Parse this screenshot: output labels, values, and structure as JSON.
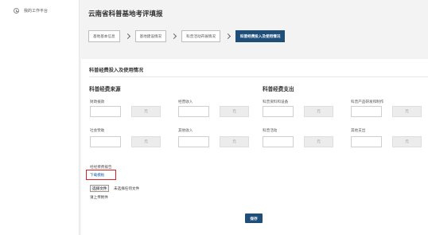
{
  "sidebar": {
    "items": [
      {
        "label": "我的工作平台",
        "icon": "clock-icon"
      }
    ]
  },
  "page": {
    "title": "云南省科普基地考评填报"
  },
  "steps": [
    {
      "label": "基地基本信息",
      "active": false
    },
    {
      "label": "基地建设情况",
      "active": false
    },
    {
      "label": "科普活动开展情况",
      "active": false
    },
    {
      "label": "科普经费投入及使用情况",
      "active": true
    }
  ],
  "form": {
    "title": "科普经费投入及使用情况",
    "income": {
      "title": "科普经费来源",
      "fields": [
        {
          "label": "财政拨款",
          "unit": "元",
          "value": ""
        },
        {
          "label": "经营收入",
          "unit": "元",
          "value": ""
        },
        {
          "label": "社会赞助",
          "unit": "元",
          "value": ""
        },
        {
          "label": "其他收入",
          "unit": "元",
          "value": ""
        }
      ]
    },
    "expense": {
      "title": "科普经费支出",
      "fields": [
        {
          "label": "科普资料和设备",
          "unit": "元",
          "value": ""
        },
        {
          "label": "科普产品研发和制作",
          "unit": "元",
          "value": ""
        },
        {
          "label": "科普活动",
          "unit": "元",
          "value": ""
        },
        {
          "label": "其他支出",
          "unit": "元",
          "value": ""
        }
      ]
    },
    "report_label": "经经费费报告",
    "download_label": "下载模板",
    "file_button_label": "选择文件",
    "file_none_label": "未选择任何文件",
    "upload_hint": "请上传附件",
    "save_label": "保存"
  },
  "colors": {
    "primary": "#1f4e79",
    "highlight": "#e02020",
    "link": "#1a5fb4"
  }
}
